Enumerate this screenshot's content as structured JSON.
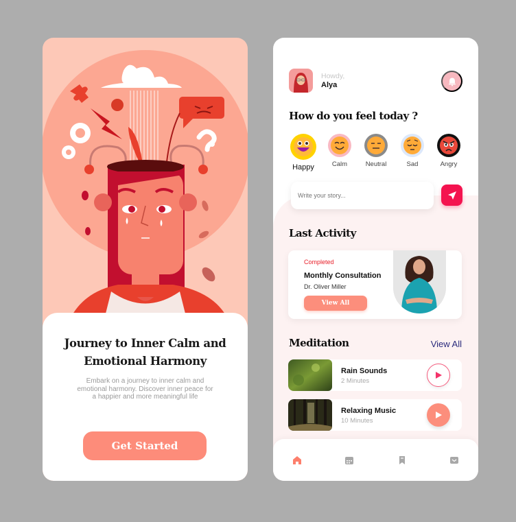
{
  "onboarding": {
    "title": "Journey to Inner Calm and Emotional Harmony",
    "description": "Embark on a journey to inner calm and emotional harmony. Discover inner peace for a happier and more meaningful life",
    "cta_label": "Get Started"
  },
  "home": {
    "greeting": "Howdy,",
    "username": "Alya",
    "feel_title": "How do you feel today ?",
    "moods": [
      {
        "label": "Happy",
        "icon": "grinning-face-icon",
        "selected": true
      },
      {
        "label": "Calm",
        "icon": "smiling-face-icon"
      },
      {
        "label": "Neutral",
        "icon": "expressionless-face-icon"
      },
      {
        "label": "Sad",
        "icon": "pensive-face-icon"
      },
      {
        "label": "Angry",
        "icon": "angry-face-icon"
      }
    ],
    "story_placeholder": "Write your story...",
    "last_activity": {
      "title": "Last Activity",
      "status": "Completed",
      "name": "Monthly Consultation",
      "doctor": "Dr. Oliver Miller",
      "button_label": "View All"
    },
    "meditation": {
      "title": "Meditation",
      "view_all_label": "View All",
      "items": [
        {
          "title": "Rain Sounds",
          "duration": "2 Minutes"
        },
        {
          "title": "Relaxing Music",
          "duration": "10 Minutes"
        }
      ]
    },
    "nav": [
      {
        "icon": "home-icon",
        "active": true
      },
      {
        "icon": "calendar-icon"
      },
      {
        "icon": "bookmark-icon"
      },
      {
        "icon": "mail-icon"
      }
    ],
    "colors": {
      "accent": "#fd8c7a",
      "send": "#f4134f",
      "status": "#e8202a",
      "link": "#2a2a7c"
    }
  }
}
